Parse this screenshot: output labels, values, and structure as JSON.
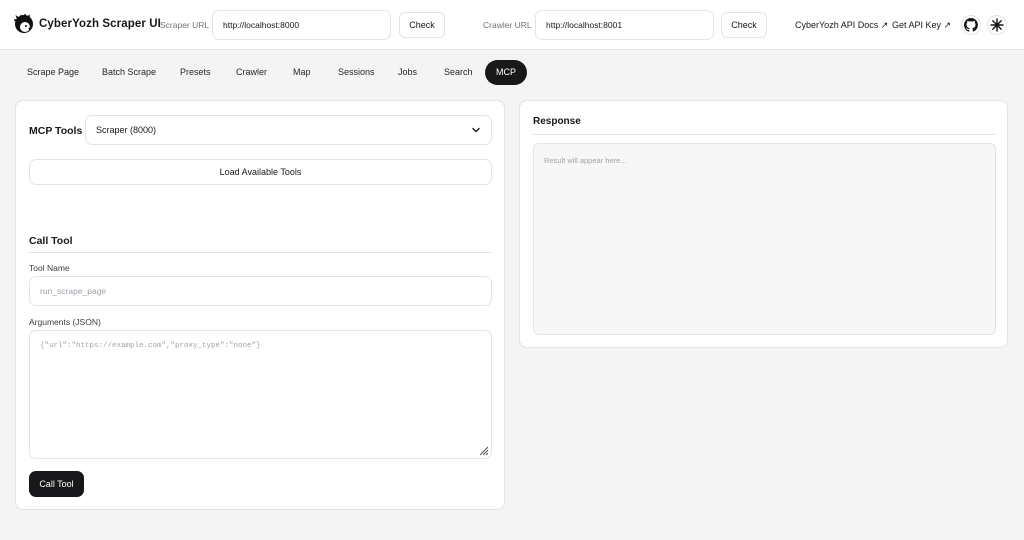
{
  "app": {
    "title": "CyberYozh Scraper UI",
    "logo_icon": "hedgehog-logo-icon"
  },
  "header": {
    "scraper_url_label": "Scraper URL",
    "scraper_url_value": "http://localhost:8000",
    "crawler_url_label": "Crawler URL",
    "crawler_url_value": "http://localhost:8001",
    "check_label": "Check",
    "api_docs_label": "CyberYozh API Docs ↗",
    "api_key_label": "Get API Key ↗",
    "github_icon": "github-icon",
    "theme_icon": "sun-icon"
  },
  "tabs": [
    {
      "label": "Scrape Page"
    },
    {
      "label": "Batch Scrape"
    },
    {
      "label": "Presets"
    },
    {
      "label": "Crawler"
    },
    {
      "label": "Map"
    },
    {
      "label": "Sessions"
    },
    {
      "label": "Jobs"
    },
    {
      "label": "Search"
    },
    {
      "label": "MCP",
      "active": true
    }
  ],
  "mcp": {
    "title": "MCP Tools",
    "server_selected": "Scraper (8000)",
    "load_button": "Load Available Tools",
    "call_title": "Call Tool",
    "tool_name_label": "Tool Name",
    "tool_name_placeholder": "run_scrape_page",
    "arguments_label": "Arguments (JSON)",
    "arguments_placeholder": "{\"url\":\"https://example.com\",\"proxy_type\":\"none\"}",
    "call_button": "Call Tool"
  },
  "response": {
    "title": "Response",
    "placeholder": "Result will appear here..."
  },
  "colors": {
    "accent": "#18181b",
    "border": "#e4e4e7",
    "background": "#f4f4f5"
  }
}
